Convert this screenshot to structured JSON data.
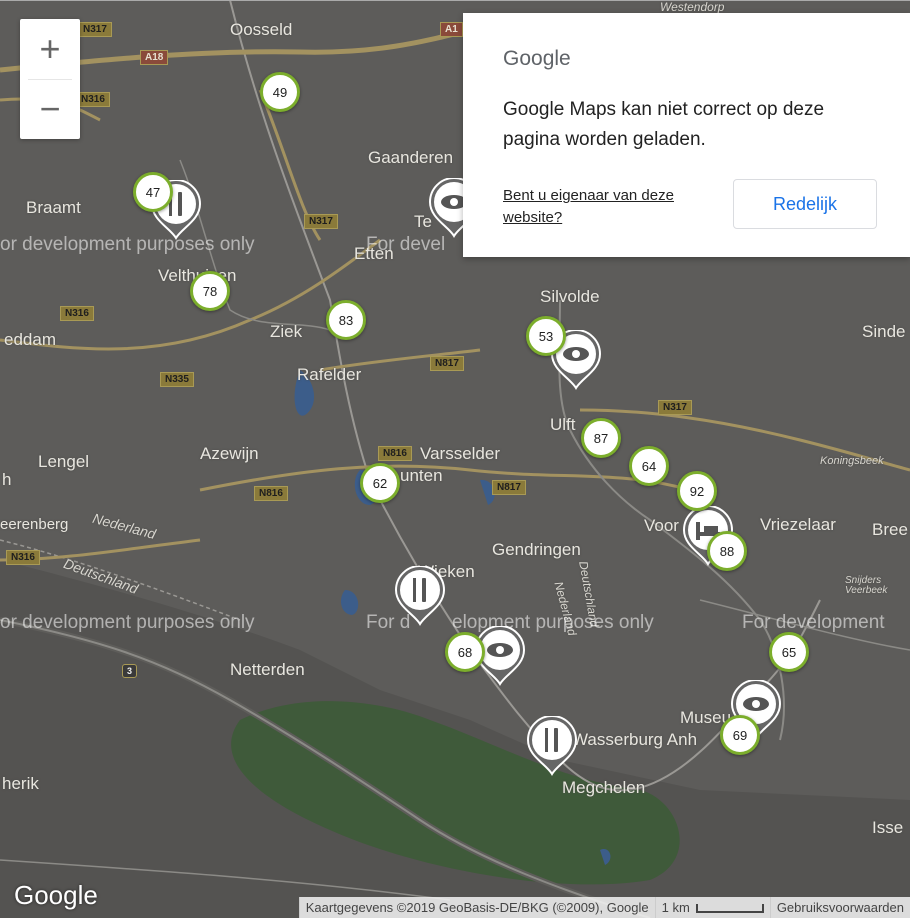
{
  "places": [
    {
      "id": "oosseld",
      "text": "Oosseld"
    },
    {
      "id": "gaanderen",
      "text": "Gaanderen"
    },
    {
      "id": "braamt",
      "text": "Braamt"
    },
    {
      "id": "etten",
      "text": "Etten"
    },
    {
      "id": "te",
      "text": "Te"
    },
    {
      "id": "velthuizen",
      "text": "Velthuizen"
    },
    {
      "id": "silvolde",
      "text": "Silvolde"
    },
    {
      "id": "ziek",
      "text": "Ziek"
    },
    {
      "id": "eddam",
      "text": "eddam"
    },
    {
      "id": "sinde",
      "text": "Sinde"
    },
    {
      "id": "rafelder",
      "text": "Rafelder"
    },
    {
      "id": "ulft",
      "text": "Ulft"
    },
    {
      "id": "lengel",
      "text": "Lengel"
    },
    {
      "id": "azewijn",
      "text": "Azewijn"
    },
    {
      "id": "varsselder",
      "text": "Varsselder"
    },
    {
      "id": "unten",
      "text": "unten"
    },
    {
      "id": "koningsbeek",
      "text": "Koningsbeek"
    },
    {
      "id": "voor",
      "text": "Voor"
    },
    {
      "id": "vriezelaar",
      "text": "Vriezelaar"
    },
    {
      "id": "bree",
      "text": "Bree"
    },
    {
      "id": "eerenberg",
      "text": "eerenberg"
    },
    {
      "id": "nederland1",
      "text": "Nederland"
    },
    {
      "id": "gendringen",
      "text": "Gendringen"
    },
    {
      "id": "deutschland1",
      "text": "Deutschland"
    },
    {
      "id": "wieken",
      "text": "Wieken"
    },
    {
      "id": "deutschland2",
      "text": "Deutschland"
    },
    {
      "id": "nederland2",
      "text": "Nederland"
    },
    {
      "id": "snijders",
      "text": "Snijders Veerbeek"
    },
    {
      "id": "netterden",
      "text": "Netterden"
    },
    {
      "id": "museum",
      "text": "Museu"
    },
    {
      "id": "wasserburg",
      "text": "Wasserburg Anh"
    },
    {
      "id": "herik",
      "text": "herik"
    },
    {
      "id": "megchelen",
      "text": "Megchelen"
    },
    {
      "id": "isse",
      "text": "Isse"
    },
    {
      "id": "h",
      "text": "h"
    },
    {
      "id": "westendorp",
      "text": "Westendorp"
    }
  ],
  "dev_watermarks": [
    "or development purposes only",
    "For devel",
    "or development purposes only",
    "For d",
    "elopment purposes only",
    "For development"
  ],
  "road_shields": [
    "N317",
    "A18",
    "N316",
    "N317",
    "N316",
    "N335",
    "N817",
    "N317",
    "N816",
    "N817",
    "N816",
    "N316",
    "3",
    "A1"
  ],
  "clusters": [
    {
      "label": "49"
    },
    {
      "label": "47"
    },
    {
      "label": "78"
    },
    {
      "label": "83"
    },
    {
      "label": "53"
    },
    {
      "label": "87"
    },
    {
      "label": "64"
    },
    {
      "label": "92"
    },
    {
      "label": "88"
    },
    {
      "label": "62"
    },
    {
      "label": "68"
    },
    {
      "label": "65"
    },
    {
      "label": "69"
    }
  ],
  "pins": [
    {
      "icon": "restaurant-icon"
    },
    {
      "icon": "eye-icon"
    },
    {
      "icon": "eye-icon"
    },
    {
      "icon": "hotel-icon"
    },
    {
      "icon": "restaurant-icon"
    },
    {
      "icon": "eye-icon"
    },
    {
      "icon": "restaurant-icon"
    },
    {
      "icon": "eye-icon"
    }
  ],
  "zoom": {
    "in": "+",
    "out": "−"
  },
  "dialog": {
    "logo": "Google",
    "message": "Google Maps kan niet correct op deze pagina worden geladen.",
    "owner_link": "Bent u eigenaar van deze website?",
    "ok_button": "Redelijk"
  },
  "google_logo": "Google",
  "footer": {
    "attribution": "Kaartgegevens ©2019 GeoBasis-DE/BKG (©2009), Google",
    "scale": "1 km",
    "terms": "Gebruiksvoorwaarden"
  },
  "colors": {
    "cluster_border": "#7cae2c",
    "map_bg": "#5b5a58",
    "button_text": "#1a73e8"
  }
}
